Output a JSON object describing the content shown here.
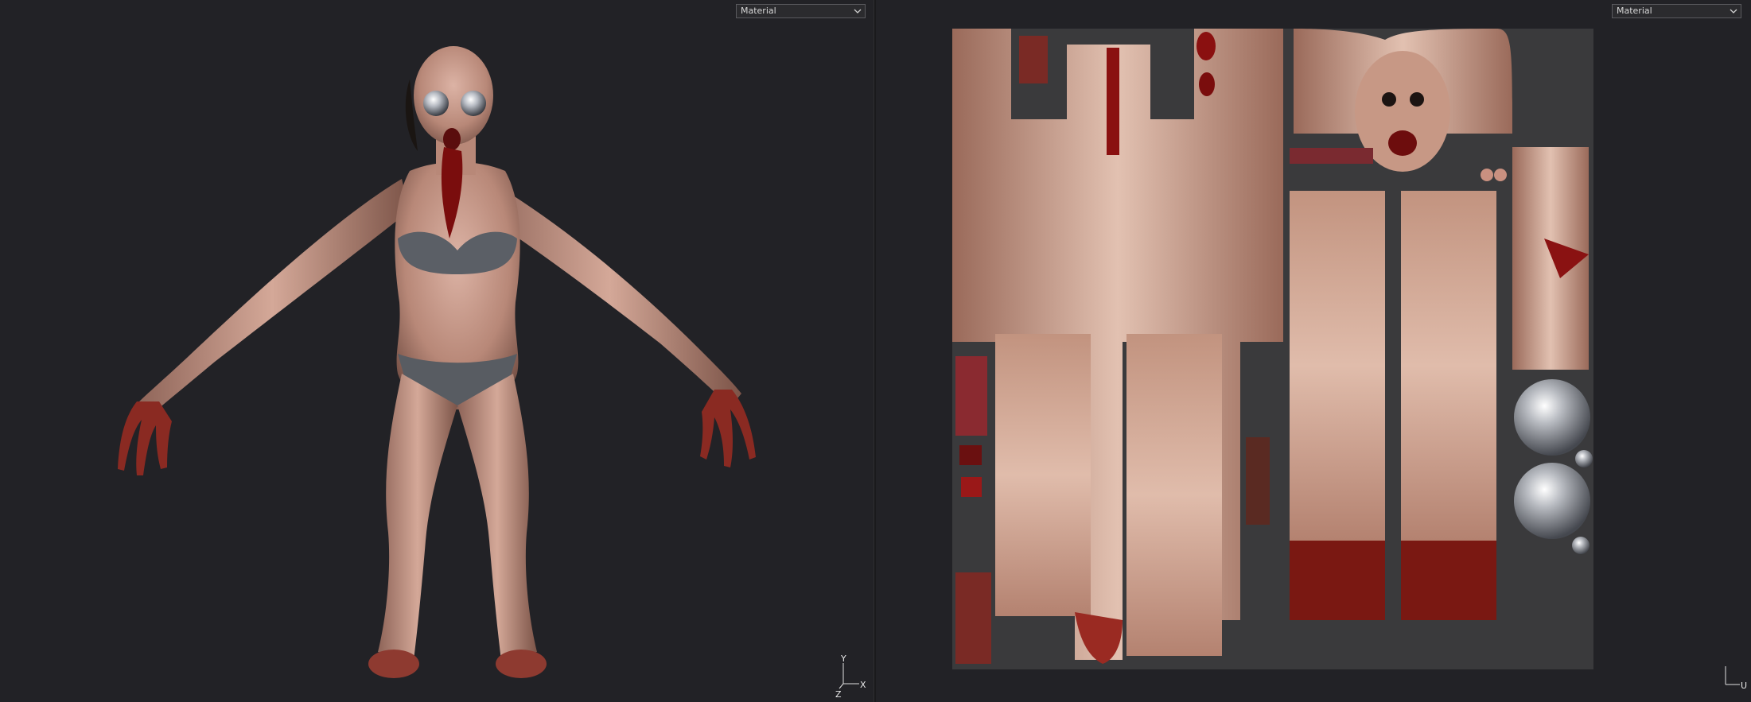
{
  "left_viewport": {
    "mode_label": "Material",
    "axis_labels": {
      "vertical": "Y",
      "horizontal": "X",
      "depth": "Z"
    }
  },
  "right_viewport": {
    "mode_label": "Material",
    "axis_labels": {
      "vertical": "",
      "horizontal": "U"
    }
  },
  "icons": {
    "dropdown": "chevron-down-icon",
    "axis": "axis-gizmo-icon"
  },
  "colors": {
    "background": "#222226",
    "skin": "#c99a8c",
    "blood": "#7a0d0d",
    "uv_canvas": "#3a3a3c"
  }
}
